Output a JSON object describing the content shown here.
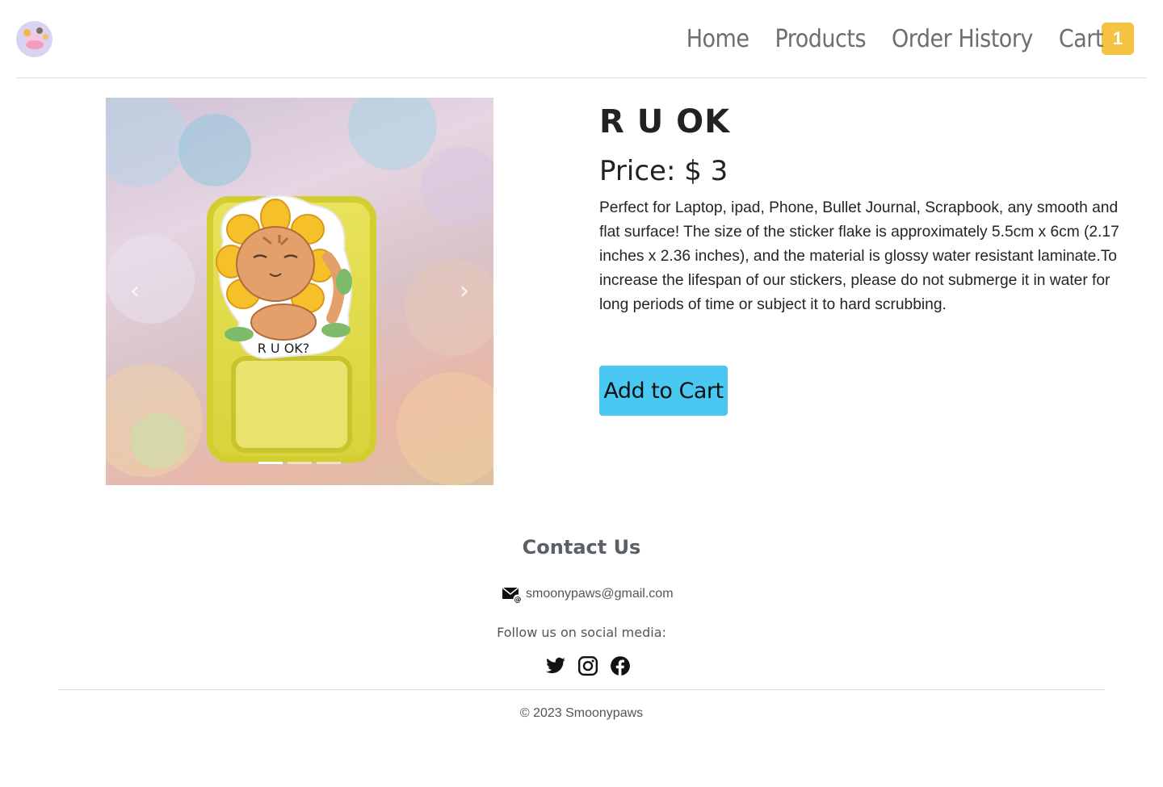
{
  "header": {
    "logo_icon": "smoonypaws-logo",
    "nav": [
      "Home",
      "Products",
      "Order History"
    ],
    "cart_label": "Cart",
    "cart_count": "1",
    "cart_badge_color": "#f5c341"
  },
  "product": {
    "title": "R U OK",
    "price_label": "Price:",
    "price_value": "$ 3",
    "description": "Perfect for Laptop, ipad, Phone, Bullet Journal, Scrapbook, any smooth and flat surface! The size of the sticker flake is approximately 5.5cm x 6cm (2.17 inches x 2.36 inches), and the material is glossy water resistant laminate.To increase the lifespan of our stickers, please do not submerge it in water for long periods of time or subject it to hard scrubbing.",
    "add_to_cart_label": "Add to Cart",
    "button_color": "#49c9f1",
    "carousel": {
      "image_text": "R U OK?",
      "prev_icon": "chevron-left-icon",
      "next_icon": "chevron-right-icon",
      "slide_count": 3,
      "active_slide": 1
    }
  },
  "footer": {
    "contact_title": "Contact Us",
    "email": "smoonypaws@gmail.com",
    "follow_text": "Follow us on social media:",
    "social_icons": [
      "twitter-icon",
      "instagram-icon",
      "facebook-icon"
    ],
    "copyright": "© 2023 Smoonypaws"
  }
}
